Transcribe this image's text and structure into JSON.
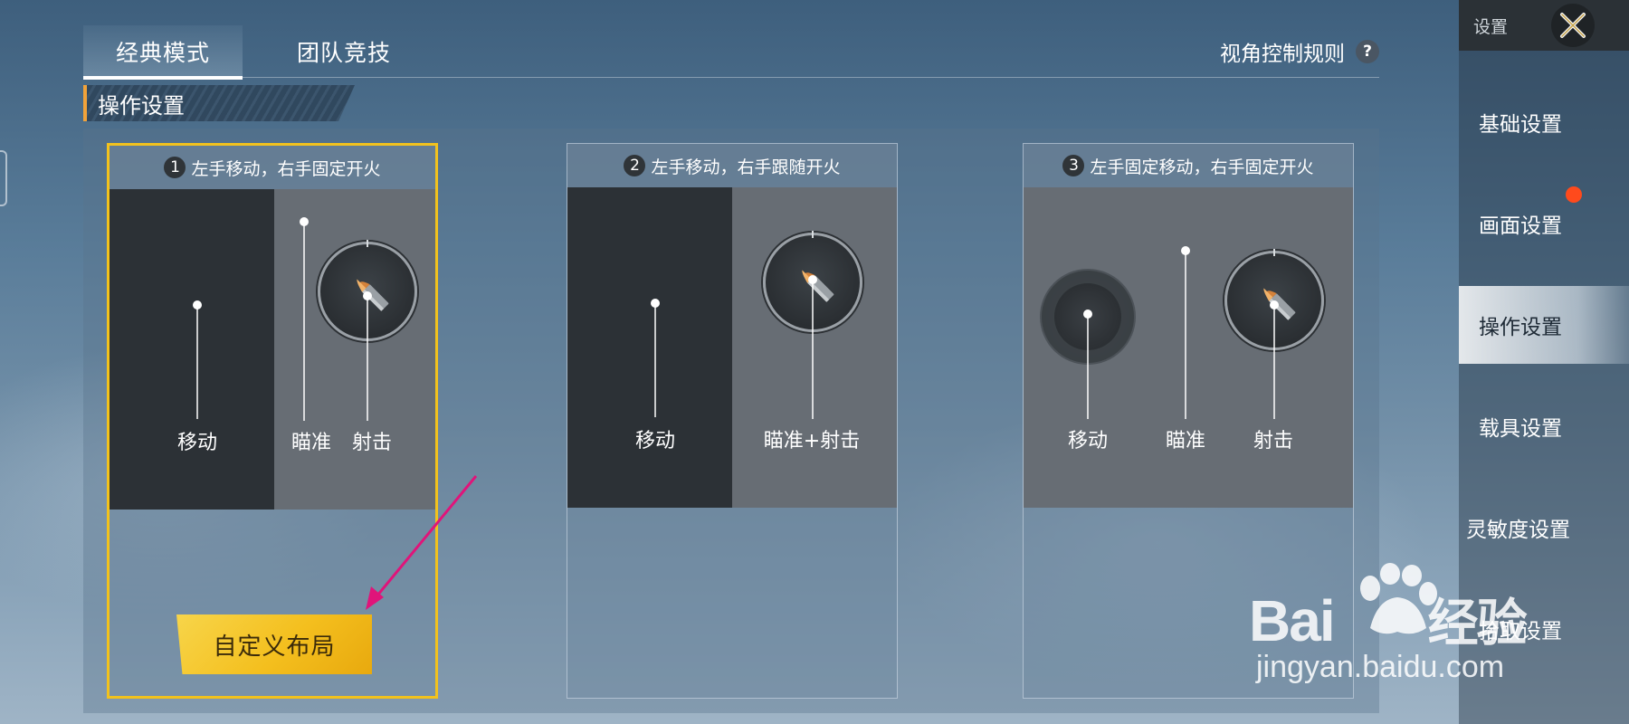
{
  "tabs": [
    {
      "label": "经典模式",
      "active": true
    },
    {
      "label": "团队竞技",
      "active": false
    }
  ],
  "view_rule": {
    "label": "视角控制规则",
    "help_symbol": "?"
  },
  "section": {
    "title": "操作设置"
  },
  "cards": [
    {
      "number": "1",
      "title": "左手移动，右手固定开火",
      "labels": [
        "移动",
        "瞄准",
        "射击"
      ],
      "selected": true,
      "button_label": "自定义布局"
    },
    {
      "number": "2",
      "title": "左手移动，右手跟随开火",
      "labels": [
        "移动",
        "瞄准+射击"
      ],
      "selected": false
    },
    {
      "number": "3",
      "title": "左手固定移动，右手固定开火",
      "labels": [
        "移动",
        "瞄准",
        "射击"
      ],
      "selected": false
    }
  ],
  "sidebar": {
    "header": "设置",
    "items": [
      {
        "label": "基础设置",
        "active": false
      },
      {
        "label": "画面设置",
        "active": false,
        "badge": true
      },
      {
        "label": "操作设置",
        "active": true
      },
      {
        "label": "载具设置",
        "active": false
      },
      {
        "label": "灵敏度设置",
        "active": false
      },
      {
        "label": "拾取设置",
        "active": false
      }
    ]
  },
  "watermark": {
    "brand_left": "Bai",
    "brand_right": "经验",
    "url": "jingyan.baidu.com"
  },
  "colors": {
    "accent_yellow": "#f2c21d",
    "badge_red": "#ff4a1c",
    "section_accent": "#f2a33a",
    "annotation_arrow": "#e0147a"
  }
}
